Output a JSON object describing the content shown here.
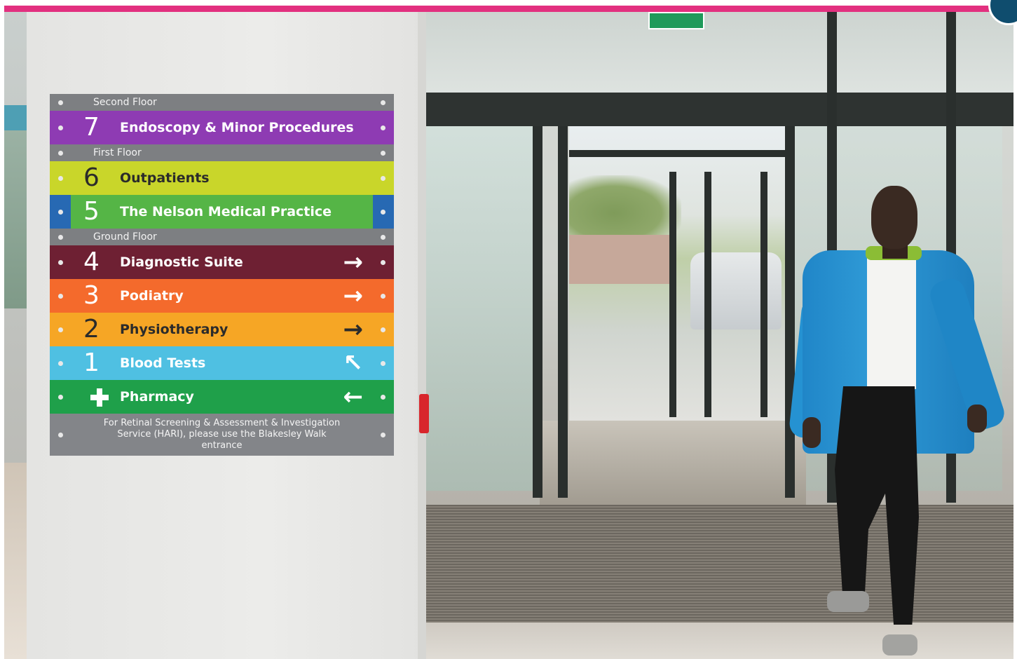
{
  "sign": {
    "sections": [
      {
        "kind": "floor",
        "label": "Second Floor"
      },
      {
        "kind": "dept",
        "number": "7",
        "name": "Endoscopy & Minor Procedures",
        "color": "#8e3bb3",
        "arrow": ""
      },
      {
        "kind": "floor",
        "label": "First Floor"
      },
      {
        "kind": "dept",
        "number": "6",
        "name": "Outpatients",
        "color": "#c9d62a",
        "arrow": ""
      },
      {
        "kind": "dept",
        "number": "5",
        "name": "The Nelson Medical Practice",
        "color": "#55b546",
        "arrow": ""
      },
      {
        "kind": "floor",
        "label": "Ground Floor"
      },
      {
        "kind": "dept",
        "number": "4",
        "name": "Diagnostic Suite",
        "color": "#6e2033",
        "arrow": "→"
      },
      {
        "kind": "dept",
        "number": "3",
        "name": "Podiatry",
        "color": "#f46a2c",
        "arrow": "→"
      },
      {
        "kind": "dept",
        "number": "2",
        "name": "Physiotherapy",
        "color": "#f6a625",
        "arrow": "→"
      },
      {
        "kind": "dept",
        "number": "1",
        "name": "Blood Tests",
        "color": "#4fc0e2",
        "arrow": "↖"
      },
      {
        "kind": "dept",
        "number": "",
        "name": "Pharmacy",
        "color": "#1fa04a",
        "arrow": "←"
      }
    ],
    "note": "For Retinal Screening & Assessment & Investigation Service (HARI), please use the Blakesley Walk entrance"
  },
  "colors": {
    "accent_bar": "#e2307f",
    "corner_circle": "#0f4d6e"
  }
}
